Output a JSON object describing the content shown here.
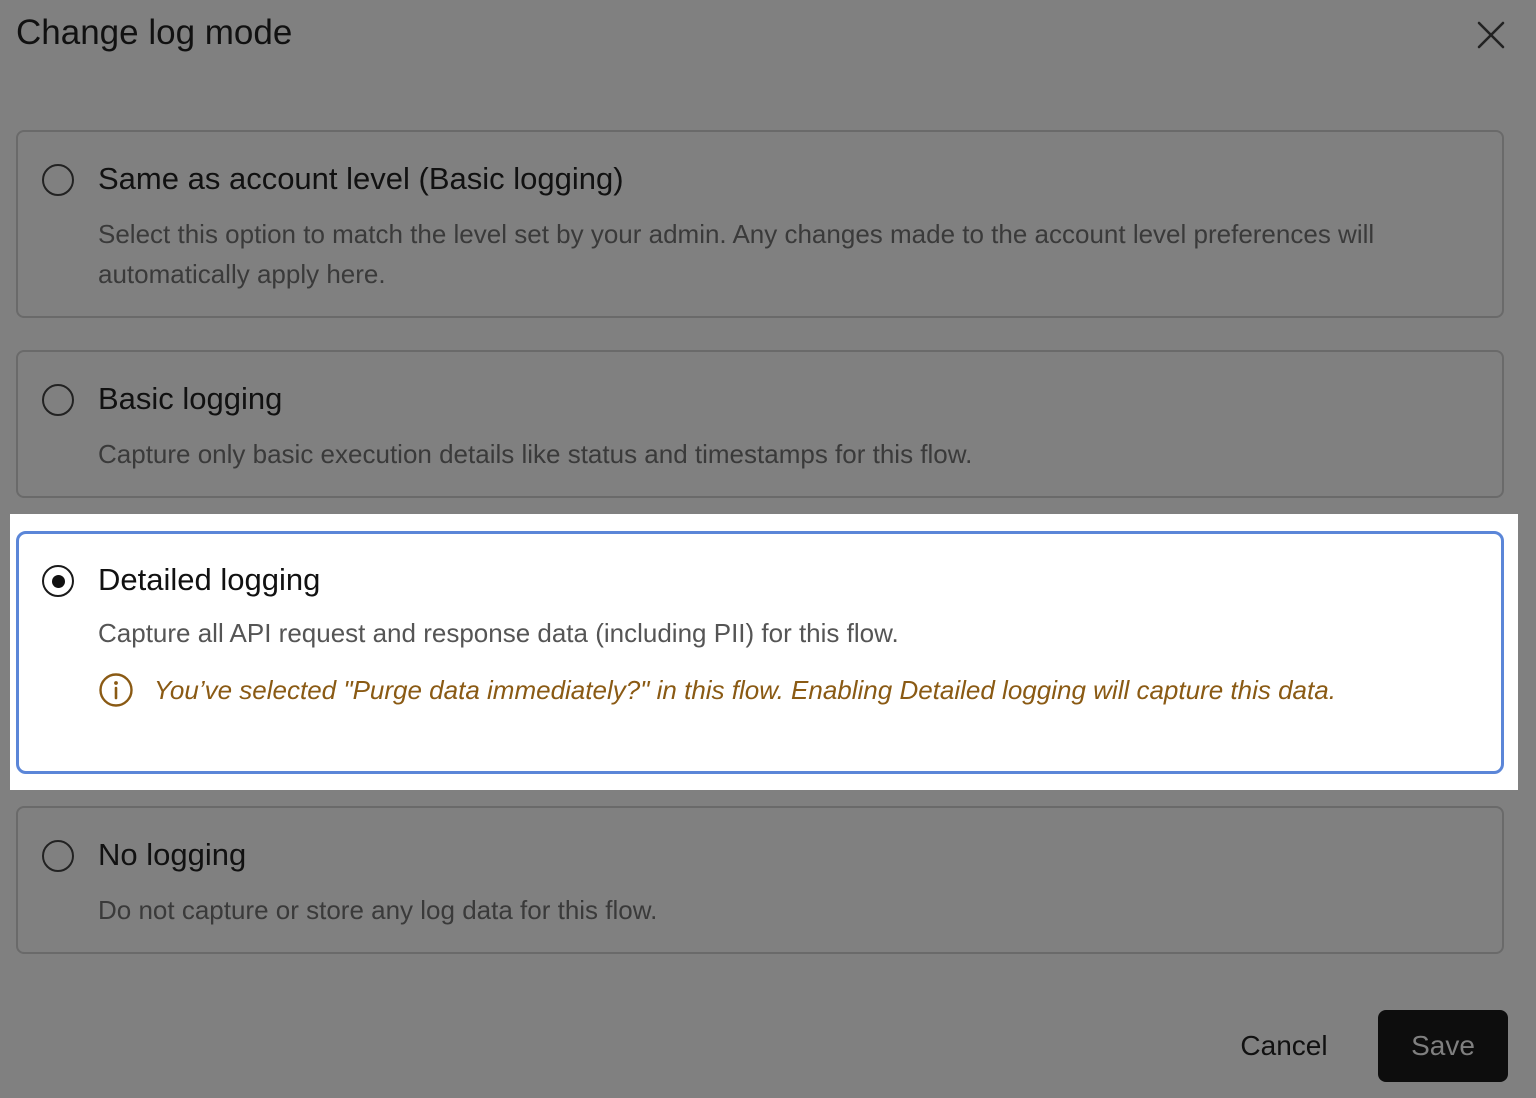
{
  "dialog": {
    "title": "Change log mode",
    "close_icon": "close-icon"
  },
  "options": [
    {
      "title": "Same as account level (Basic logging)",
      "description": "Select this option to match the level set by your admin. Any changes made to the account level preferences will automatically apply here.",
      "selected": false
    },
    {
      "title": "Basic logging",
      "description": "Capture only basic execution details like status and timestamps for this flow.",
      "selected": false
    },
    {
      "title": "Detailed logging",
      "description": "Capture all API request and response data (including PII) for this flow.",
      "selected": true,
      "warning": {
        "icon": "info-circle-icon",
        "text": "You’ve selected \"Purge data immediately?\" in this flow. Enabling Detailed logging will capture this data."
      }
    },
    {
      "title": "No logging",
      "description": "Do not capture or store any log data for this flow.",
      "selected": false
    }
  ],
  "actions": {
    "cancel_label": "Cancel",
    "save_label": "Save"
  },
  "colors": {
    "overlay": "#808080",
    "selected_border": "#5b86d8",
    "warning_text": "#8a5a14",
    "save_button_bg": "#0d0d0d"
  }
}
